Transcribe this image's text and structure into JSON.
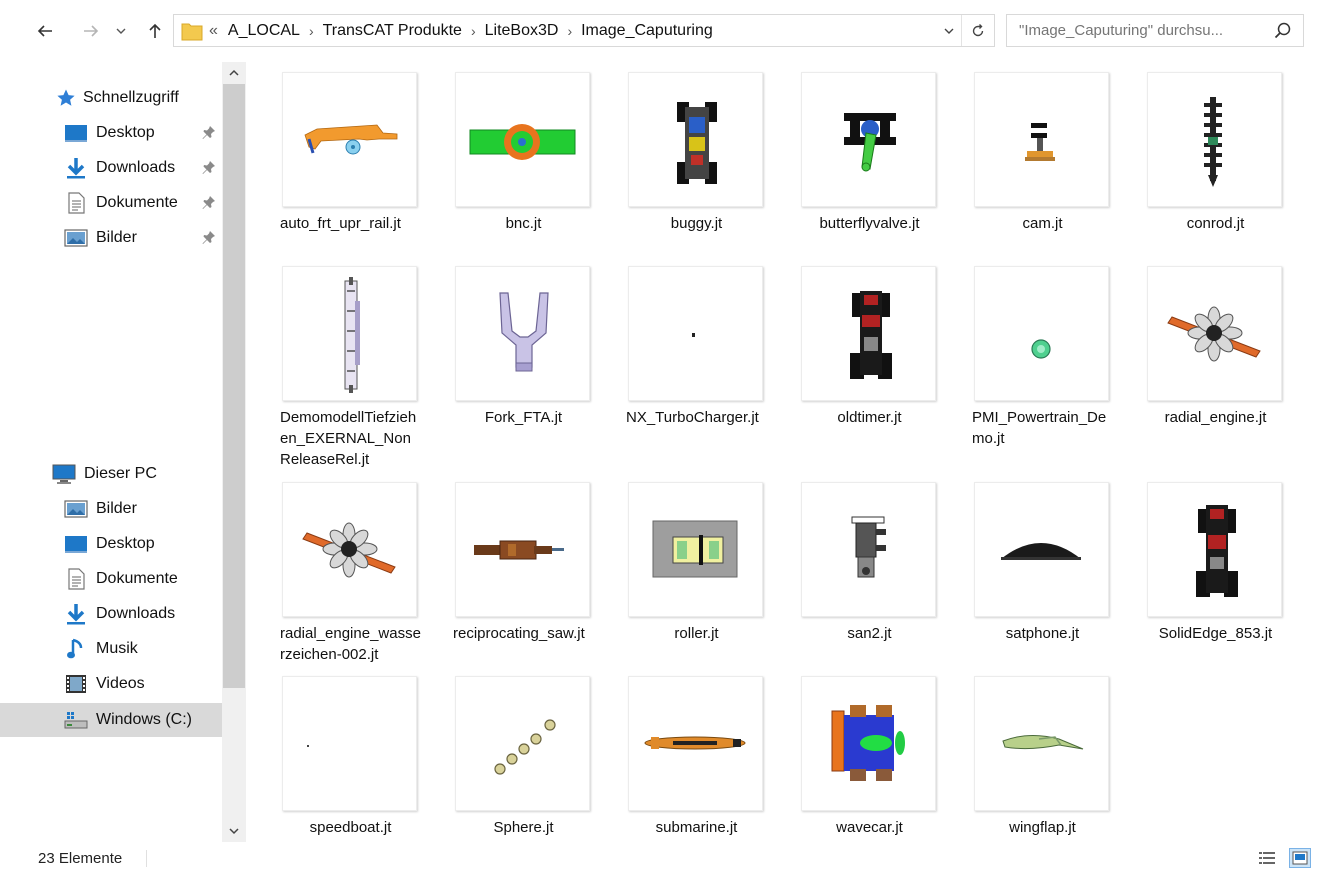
{
  "address": {
    "overflow": "«",
    "crumbs": [
      "A_LOCAL",
      "TransCAT Produkte",
      "LiteBox3D",
      "Image_Caputuring"
    ]
  },
  "search": {
    "placeholder": "\"Image_Caputuring\" durchsu..."
  },
  "sidebar": {
    "quick_access": "Schnellzugriff",
    "quick_items": [
      "Desktop",
      "Downloads",
      "Dokumente",
      "Bilder"
    ],
    "this_pc": "Dieser PC",
    "pc_items": [
      "Bilder",
      "Desktop",
      "Dokumente",
      "Downloads",
      "Musik",
      "Videos",
      "Windows (C:)"
    ]
  },
  "files": [
    {
      "name": "auto_frt_upr_rail.jt",
      "icon": "auto-rail-thumbnail"
    },
    {
      "name": "bnc.jt",
      "icon": "bnc-thumbnail"
    },
    {
      "name": "buggy.jt",
      "icon": "buggy-thumbnail"
    },
    {
      "name": "butterflyvalve.jt",
      "icon": "valve-thumbnail"
    },
    {
      "name": "cam.jt",
      "icon": "cam-thumbnail"
    },
    {
      "name": "conrod.jt",
      "icon": "conrod-thumbnail"
    },
    {
      "name": "DemomodellTiefziehen_EXERNAL_NonReleaseRel.jt",
      "icon": "demomodell-thumbnail"
    },
    {
      "name": "Fork_FTA.jt",
      "icon": "fork-thumbnail"
    },
    {
      "name": "NX_TurboCharger.jt",
      "icon": "turbocharger-thumbnail"
    },
    {
      "name": "oldtimer.jt",
      "icon": "oldtimer-thumbnail"
    },
    {
      "name": "PMI_Powertrain_Demo.jt",
      "icon": "powertrain-thumbnail"
    },
    {
      "name": "radial_engine.jt",
      "icon": "radial-engine-thumbnail"
    },
    {
      "name": "radial_engine_wasserzeichen-002.jt",
      "icon": "radial-engine-thumbnail"
    },
    {
      "name": "reciprocating_saw.jt",
      "icon": "saw-thumbnail"
    },
    {
      "name": "roller.jt",
      "icon": "roller-thumbnail"
    },
    {
      "name": "san2.jt",
      "icon": "san2-thumbnail"
    },
    {
      "name": "satphone.jt",
      "icon": "satphone-thumbnail"
    },
    {
      "name": "SolidEdge_853.jt",
      "icon": "solidedge-thumbnail"
    },
    {
      "name": "speedboat.jt",
      "icon": "speedboat-thumbnail"
    },
    {
      "name": "Sphere.jt",
      "icon": "sphere-thumbnail"
    },
    {
      "name": "submarine.jt",
      "icon": "submarine-thumbnail"
    },
    {
      "name": "wavecar.jt",
      "icon": "wavecar-thumbnail"
    },
    {
      "name": "wingflap.jt",
      "icon": "wingflap-thumbnail"
    }
  ],
  "status": {
    "count": "23 Elemente"
  }
}
